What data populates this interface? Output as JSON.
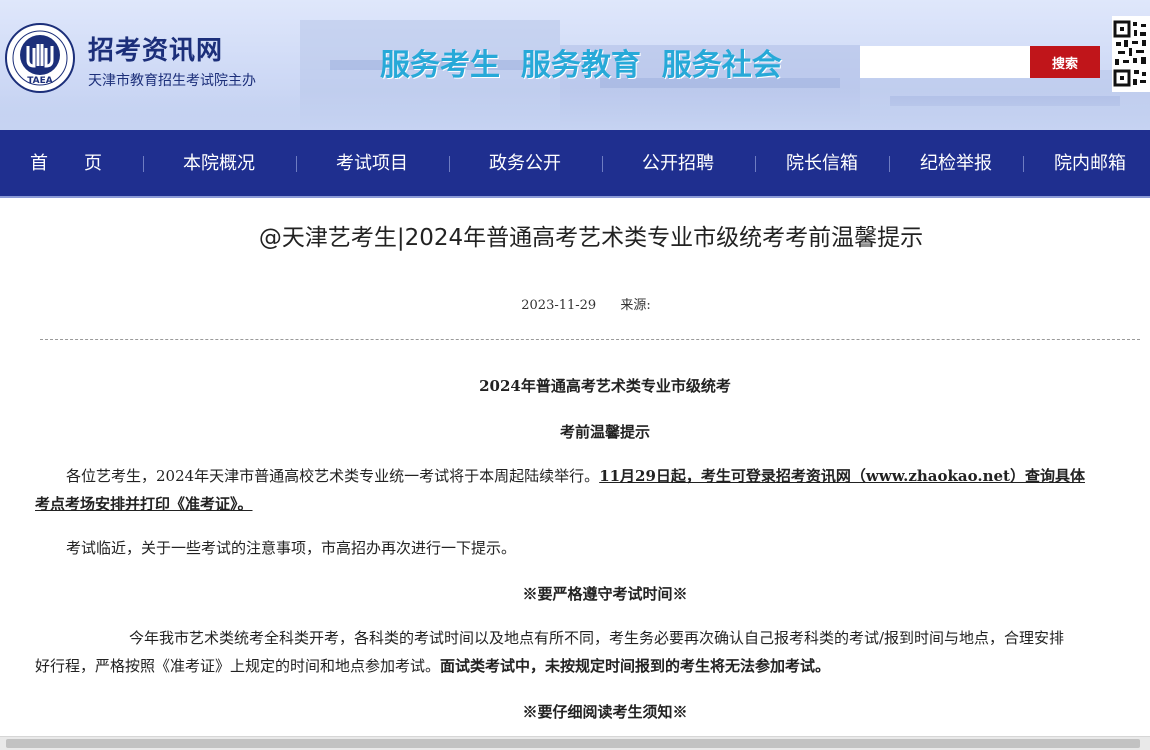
{
  "header": {
    "site_title": "招考资讯网",
    "site_subtitle": "天津市教育招生考试院主办",
    "logo_text": "TAEA",
    "slogan": "服务考生  服务教育  服务社会",
    "search_placeholder": "",
    "search_button": "搜索",
    "colors": {
      "slogan": "#27a9d8",
      "title": "#1c2f7a",
      "search_button": "#c0151a"
    }
  },
  "nav": {
    "items": [
      "首　　页",
      "本院概况",
      "考试项目",
      "政务公开",
      "公开招聘",
      "院长信箱",
      "纪检举报",
      "院内邮箱"
    ],
    "color": "#1f2f8f"
  },
  "article": {
    "title": "@天津艺考生|2024年普通高考艺术类专业市级统考考前温馨提示",
    "date": "2023-11-29",
    "source_label": "来源:",
    "heading1": "2024年普通高考艺术类专业市级统考",
    "heading2": "考前温馨提示",
    "p1_normal": "各位艺考生，2024年天津市普通高校艺术类专业统一考试将于本周起陆续举行。",
    "p1_bold_a": "11月29日起，考生可登录招考资讯网（www.zhaokao.net）查询具体",
    "p1_bold_b": "考点考场安排并打印《准考证》。",
    "p2": "考试临近，关于一些考试的注意事项，市高招办再次进行一下提示。",
    "section1": "※要严格遵守考试时间※",
    "p3_line1": "今年我市艺术类统考全科类开考，各科类的考试时间以及地点有所不同，考生务必要再次确认自己报考科类的考试/报到时间与地点，合理安排",
    "p3_line2_normal": "好行程，严格按照《准考证》上规定的时间和地点参加考试。",
    "p3_line2_bold": "面试类考试中，未按规定时间报到的考生将无法参加考试。",
    "section2": "※要仔细阅读考生须知※"
  }
}
